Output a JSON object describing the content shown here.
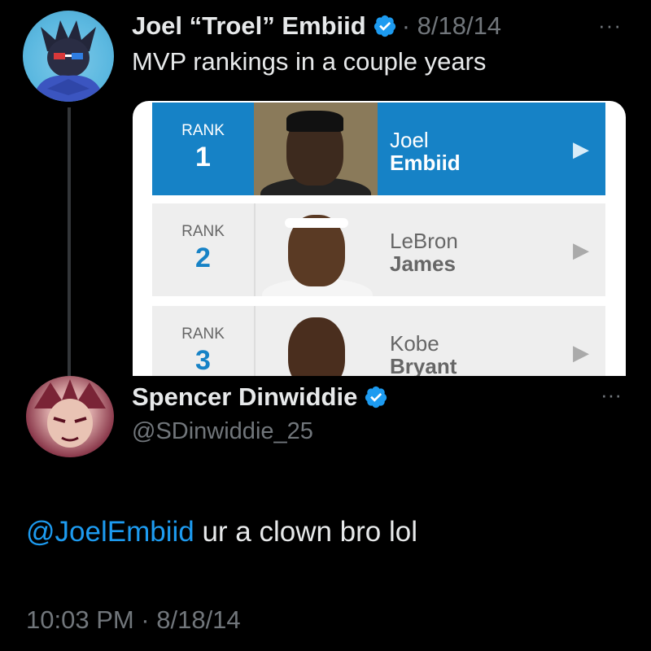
{
  "original_tweet": {
    "display_name": "Joel “Troel” Embiid",
    "meta": "· 8/18/14",
    "more_icon": "more-horizontal-icon",
    "text": "MVP rankings in a couple years",
    "media": {
      "ranks": [
        {
          "label": "RANK",
          "number": "1",
          "first": "Joel",
          "last": "Embiid",
          "highlighted": true
        },
        {
          "label": "RANK",
          "number": "2",
          "first": "LeBron",
          "last": "James",
          "highlighted": false
        },
        {
          "label": "RANK",
          "number": "3",
          "first": "Kobe",
          "last": "Bryant",
          "highlighted": false
        }
      ]
    }
  },
  "reply_tweet": {
    "display_name": "Spencer Dinwiddie",
    "handle": "@SDinwiddie_25",
    "mention": "@JoelEmbiid",
    "text": " ur a clown bro lol",
    "timestamp": "10:03 PM · 8/18/14"
  },
  "colors": {
    "background": "#000000",
    "text": "#e7e9ea",
    "secondary_text": "#71767b",
    "link": "#1d9bf0",
    "verified": "#1d9bf0",
    "rank_highlight": "#1682c6"
  }
}
